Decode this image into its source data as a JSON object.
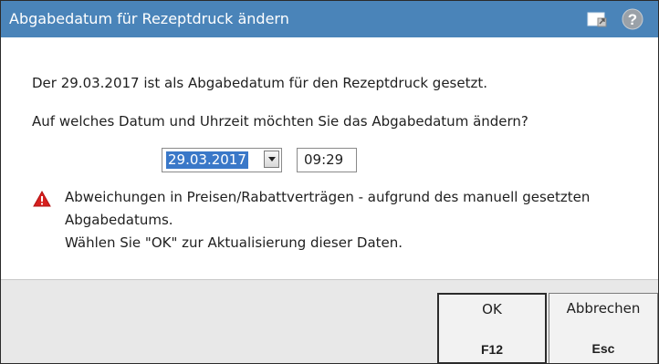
{
  "window": {
    "title": "Abgabedatum für Rezeptdruck ändern",
    "icons": [
      "window-restore-icon",
      "help-icon"
    ]
  },
  "content": {
    "info_line": "Der 29.03.2017 ist als Abgabedatum für den Rezeptdruck gesetzt.",
    "question": "Auf welches Datum und Uhrzeit möchten Sie das Abgabedatum ändern?",
    "date_value": "29.03.2017",
    "time_value": "09:29",
    "warning": {
      "icon": "warning-icon",
      "line1": "Abweichungen in Preisen/Rabattverträgen - aufgrund des manuell gesetzten",
      "line2": "Abgabedatums.",
      "line3": "Wählen Sie \"OK\" zur Aktualisierung dieser Daten."
    }
  },
  "footer": {
    "ok": {
      "label": "OK",
      "key": "F12"
    },
    "cancel": {
      "label": "Abbrechen",
      "key": "Esc"
    }
  },
  "colors": {
    "titlebar": "#4a84b9",
    "selection": "#3a78c8",
    "warning": "#d6201f",
    "footer_bg": "#e8e8e8"
  }
}
